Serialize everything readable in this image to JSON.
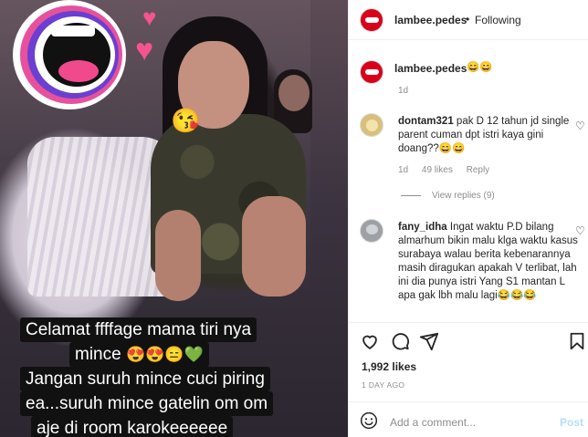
{
  "caption": {
    "line1": "Celamat ffffage mama tiri nya",
    "line2_text": "mince",
    "line2_emoji": "😍😍😑💚",
    "line3": "Jangan suruh mince cuci piring",
    "line4": "ea...suruh mince gatelin om om",
    "line5": "aje di room karokeeeeee"
  },
  "header": {
    "username": "lambee.pedes",
    "separator": "•",
    "follow_label": "Following"
  },
  "post_caption": {
    "username": "lambee.pedes",
    "text": "😄😄",
    "time": "1d"
  },
  "comments": [
    {
      "username": "dontam321",
      "text": "pak D 12 tahun jd single parent cuman dpt istri kaya gini doang??😄😄",
      "time": "1d",
      "likes": "49 likes",
      "reply": "Reply",
      "view_replies": "View replies (9)"
    },
    {
      "username": "fany_idha",
      "text": "Ingat waktu P.D bilang almarhum bikin malu klga waktu kasus surabaya walau berita kebenarannya masih diragukan apakah V terlibat, lah ini dia punya istri Yang S1 mantan L apa gak lbh malu lagi😂😂😂"
    }
  ],
  "footer": {
    "likes": "1,992 likes",
    "date": "1 DAY AGO",
    "add_comment_placeholder": "Add a comment...",
    "post_label": "Post"
  },
  "colors": {
    "brand_red": "#d9001b",
    "post_disabled": "#b2dffc",
    "muted": "#8e8e8e"
  }
}
